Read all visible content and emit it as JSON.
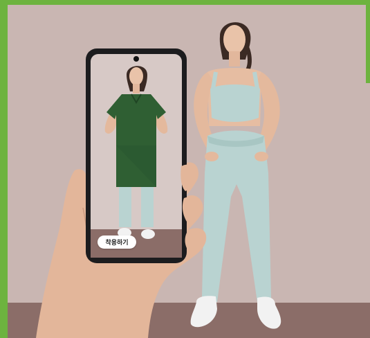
{
  "phone": {
    "try_on_button_label": "착용하기"
  },
  "colors": {
    "frame_green": "#6db33f",
    "wall": "#c9b6b2",
    "floor": "#8b6d68",
    "outfit_leggings": "#b9d3d1",
    "dress_green": "#2f5f33",
    "phone_body": "#1c1c1e"
  }
}
